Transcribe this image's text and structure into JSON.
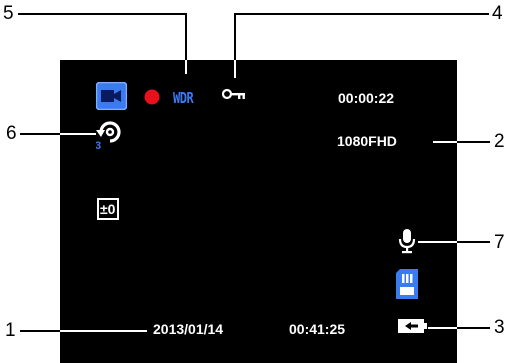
{
  "callouts": {
    "c1": "1",
    "c2": "2",
    "c3": "3",
    "c4": "4",
    "c5": "5",
    "c6": "6",
    "c7": "7"
  },
  "osd": {
    "wdr_label": "WDR",
    "timer": "00:00:22",
    "resolution": "1080FHD",
    "date": "2013/01/14",
    "time": "00:41:25",
    "exposure": "±0"
  },
  "icons": {
    "mode": "video-camera-icon",
    "record": "recording-dot-icon",
    "wdr": "wdr-icon",
    "lock": "key-lock-icon",
    "loop": "loop-recording-icon",
    "exposure": "exposure-icon",
    "mic": "microphone-icon",
    "sd": "sd-card-icon",
    "power": "power-plug-icon"
  },
  "colors": {
    "screen": "#000000",
    "accent_blue": "#3a7bf0",
    "record_red": "#e8101c",
    "osd_text": "#ffffff"
  }
}
